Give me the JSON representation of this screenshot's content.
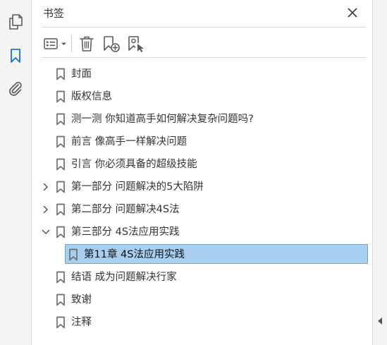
{
  "panel": {
    "title": "书签",
    "close_icon": "close-icon",
    "toolbar": {
      "options_icon": "options-list-icon",
      "delete_icon": "trash-icon",
      "new_bookmark_icon": "new-bookmark-icon",
      "bookmark_from_structure_icon": "bookmark-cursor-icon"
    }
  },
  "rail": {
    "items": [
      {
        "icon": "pages-icon",
        "active": false
      },
      {
        "icon": "bookmark-icon",
        "active": true
      },
      {
        "icon": "paperclip-icon",
        "active": false
      }
    ]
  },
  "colors": {
    "accent": "#1473e6",
    "selected_bg": "#a9cfee",
    "selected_border": "#6fa6d4",
    "text": "#333333",
    "icon": "#6e6e6e"
  },
  "bookmarks": [
    {
      "label": "封面",
      "level": 0,
      "expander": "none",
      "selected": false
    },
    {
      "label": "版权信息",
      "level": 0,
      "expander": "none",
      "selected": false
    },
    {
      "label": "测一测 你知道高手如何解决复杂问题吗?",
      "level": 0,
      "expander": "none",
      "selected": false
    },
    {
      "label": "前言 像高手一样解决问题",
      "level": 0,
      "expander": "none",
      "selected": false
    },
    {
      "label": "引言 你必须具备的超级技能",
      "level": 0,
      "expander": "none",
      "selected": false
    },
    {
      "label": "第一部分 问题解决的5大陷阱",
      "level": 0,
      "expander": "collapsed",
      "selected": false
    },
    {
      "label": "第二部分 问题解决4S法",
      "level": 0,
      "expander": "collapsed",
      "selected": false
    },
    {
      "label": "第三部分 4S法应用实践",
      "level": 0,
      "expander": "expanded",
      "selected": false
    },
    {
      "label": "第11章 4S法应用实践",
      "level": 1,
      "expander": "none",
      "selected": true
    },
    {
      "label": "结语 成为问题解决行家",
      "level": 0,
      "expander": "none",
      "selected": false
    },
    {
      "label": "致谢",
      "level": 0,
      "expander": "none",
      "selected": false
    },
    {
      "label": "注释",
      "level": 0,
      "expander": "none",
      "selected": false
    }
  ]
}
